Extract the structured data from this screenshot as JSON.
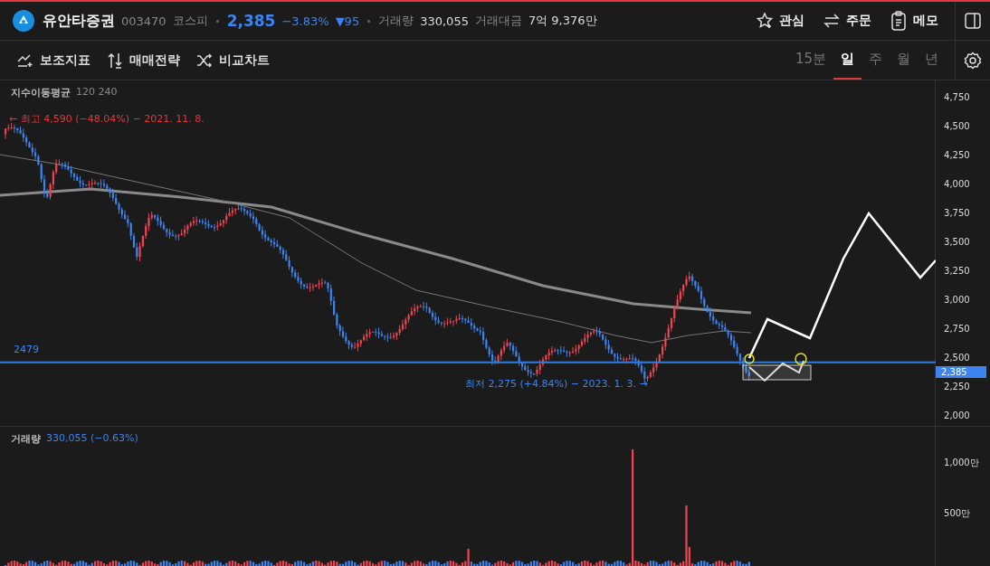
{
  "header": {
    "name": "유안타증권",
    "code": "003470",
    "market": "코스피",
    "price": "2,385",
    "change_pct": "−3.83%",
    "change_abs": "▼95",
    "volume_label": "거래량",
    "volume_value": "330,055",
    "amount_label": "거래대금",
    "amount_value": "7억 9,376만",
    "actions": [
      {
        "kind": "star",
        "label": "관심"
      },
      {
        "kind": "swap",
        "label": "주문"
      },
      {
        "kind": "memo",
        "label": "메모"
      }
    ]
  },
  "toolbar": {
    "tools": [
      {
        "kind": "indicator",
        "label": "보조지표"
      },
      {
        "kind": "strategy",
        "label": "매매전략"
      },
      {
        "kind": "compare",
        "label": "비교차트"
      }
    ],
    "periods": [
      {
        "label": "15분",
        "selected": false
      },
      {
        "label": "일",
        "selected": true
      },
      {
        "label": "주",
        "selected": false
      },
      {
        "label": "월",
        "selected": false
      },
      {
        "label": "년",
        "selected": false
      }
    ]
  },
  "chart": {
    "indicator_label": "지수이동평균",
    "indicator_params": "120 240",
    "high_note": "← 최고 4,590 (−48.04%) − 2021. 11. 8.",
    "low_note": "최저 2,275 (+4.84%) − 2023. 1. 3. →",
    "line_label": "2479",
    "price_tag": "2,385",
    "y_ticks": [
      "4,750",
      "4,500",
      "4,250",
      "4,000",
      "3,750",
      "3,500",
      "3,250",
      "3,000",
      "2,750",
      "2,500",
      "2,250",
      "2,000"
    ]
  },
  "volume": {
    "label": "거래량",
    "value": "330,055 (−0.63%)",
    "ticks": [
      "1,000만",
      "500만"
    ]
  }
}
